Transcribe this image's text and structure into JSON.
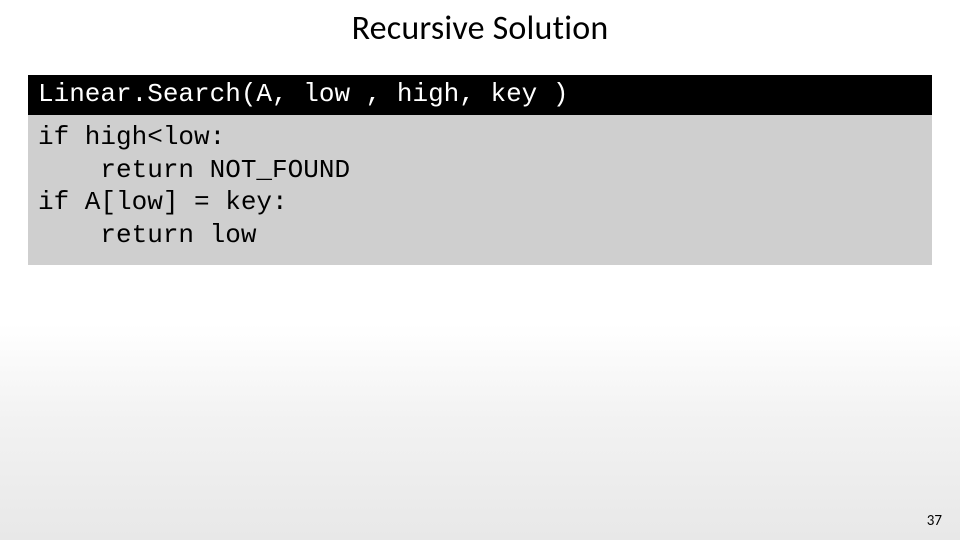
{
  "slide": {
    "title": "Recursive Solution",
    "page_number": "37"
  },
  "code": {
    "signature": "Linear.Search(A, low , high, key )",
    "body": "if high<low:\n    return NOT_FOUND\nif A[low] = key:\n    return low"
  }
}
